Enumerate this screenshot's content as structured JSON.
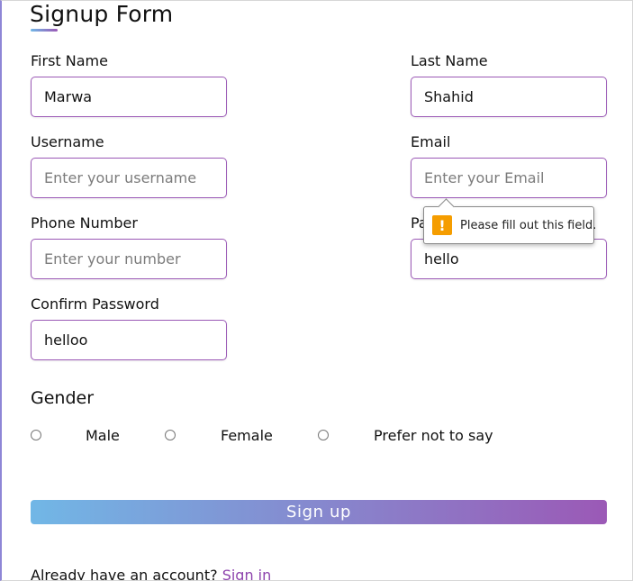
{
  "form": {
    "title": "Signup Form",
    "first_name": {
      "label": "First Name",
      "value": "Marwa",
      "placeholder": ""
    },
    "last_name": {
      "label": "Last Name",
      "value": "Shahid",
      "placeholder": ""
    },
    "username": {
      "label": "Username",
      "value": "",
      "placeholder": "Enter your username"
    },
    "email": {
      "label": "Email",
      "value": "",
      "placeholder": "Enter your Email"
    },
    "phone": {
      "label": "Phone Number",
      "value": "",
      "placeholder": "Enter your number"
    },
    "password": {
      "label": "Pa",
      "value": "hello",
      "placeholder": ""
    },
    "confirm_password": {
      "label": "Confirm Password",
      "value": "helloo",
      "placeholder": ""
    },
    "gender": {
      "title": "Gender",
      "options": [
        "Male",
        "Female",
        "Prefer not to say"
      ]
    },
    "submit_label": "Sign up",
    "signin_prompt": "Already have an account?",
    "signin_link": "Sign in"
  },
  "validation_tooltip": {
    "icon": "warning-icon",
    "icon_glyph": "!",
    "message": "Please fill out this field."
  },
  "colors": {
    "accent_start": "#71b7e6",
    "accent_end": "#9b59b6",
    "warning": "#f59d00"
  }
}
